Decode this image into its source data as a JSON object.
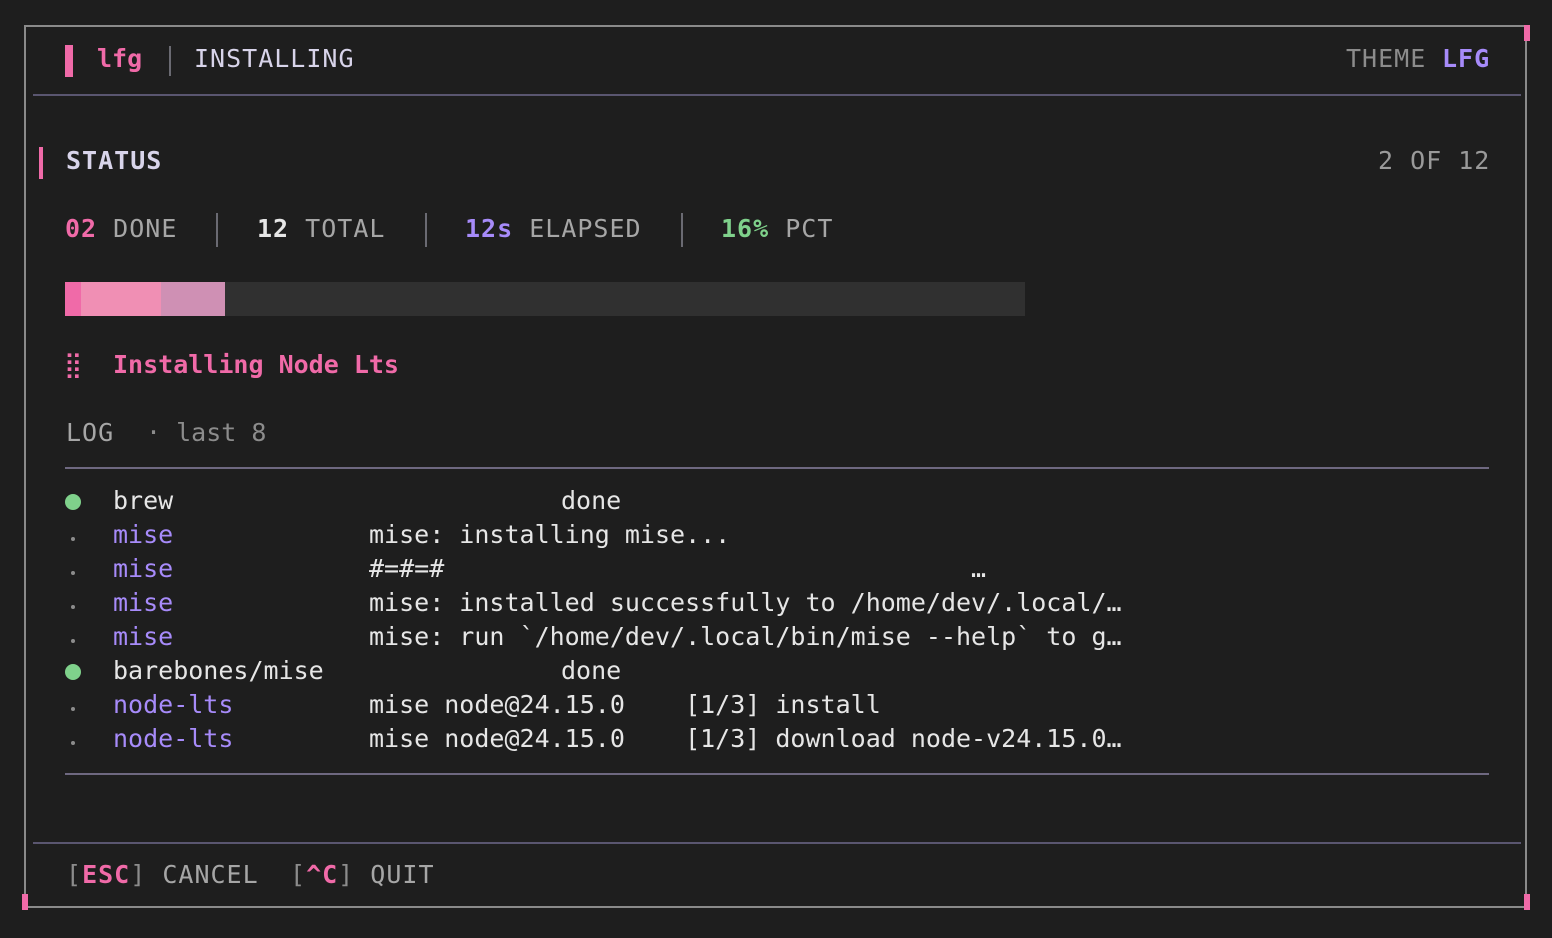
{
  "header": {
    "logo": "lfg",
    "title": "INSTALLING",
    "theme_label": "THEME",
    "theme_value": "LFG"
  },
  "status": {
    "title": "STATUS",
    "count": "2 OF 12",
    "stats": [
      {
        "num": "02",
        "label": "DONE",
        "color": "#f06aa8"
      },
      {
        "num": "12",
        "label": "TOTAL",
        "color": "#e6e6e6"
      },
      {
        "num": "12s",
        "label": "ELAPSED",
        "color": "#a78bfa"
      },
      {
        "num": "16%",
        "label": "PCT",
        "color": "#7fd18b"
      }
    ],
    "progress_fraction": 0.1667
  },
  "current_task": {
    "icon": "spinner-icon",
    "glyph": "⣿",
    "label": "Installing Node Lts"
  },
  "log": {
    "title": "LOG",
    "subtitle": "· last 8",
    "rows": [
      {
        "kind": "done",
        "source": "brew",
        "message": "done"
      },
      {
        "kind": "minor",
        "source": "mise",
        "message": "mise: installing mise..."
      },
      {
        "kind": "minor",
        "source": "mise",
        "message": "#=#=#                                   …"
      },
      {
        "kind": "minor",
        "source": "mise",
        "message": "mise: installed successfully to /home/dev/.local/…"
      },
      {
        "kind": "minor",
        "source": "mise",
        "message": "mise: run `/home/dev/.local/bin/mise --help` to g…"
      },
      {
        "kind": "done",
        "source": "barebones/mise",
        "message": "done"
      },
      {
        "kind": "minor",
        "source": "node-lts",
        "message": "mise node@24.15.0    [1/3] install"
      },
      {
        "kind": "minor",
        "source": "node-lts",
        "message": "mise node@24.15.0    [1/3] download node-v24.15.0…"
      }
    ]
  },
  "footer": {
    "actions": [
      {
        "key": "ESC",
        "label": "CANCEL"
      },
      {
        "key": "^C",
        "label": "QUIT"
      }
    ]
  },
  "colors": {
    "accent_pink": "#f06aa8",
    "accent_purple": "#a78bfa",
    "success_green": "#7fd18b",
    "background": "#1e1e1e"
  }
}
